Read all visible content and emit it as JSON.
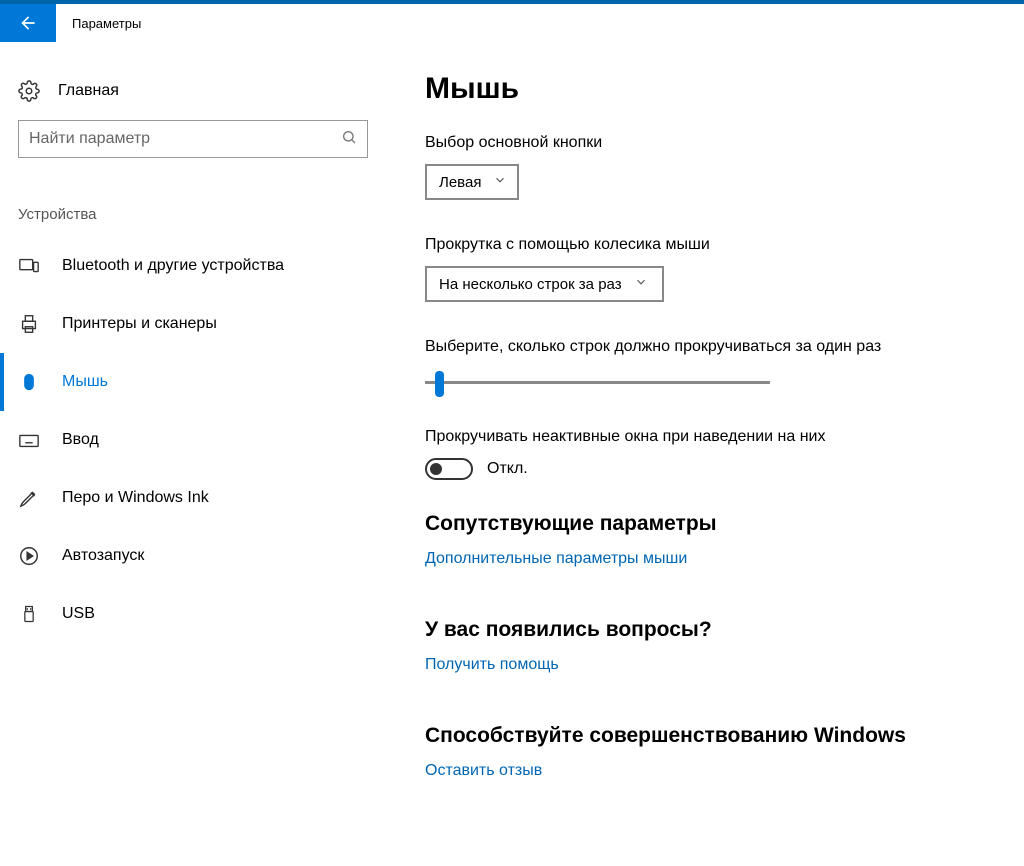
{
  "titlebar": {
    "title": "Параметры"
  },
  "sidebar": {
    "home": "Главная",
    "search_placeholder": "Найти параметр",
    "category": "Устройства",
    "items": [
      {
        "label": "Bluetooth и другие устройства"
      },
      {
        "label": "Принтеры и сканеры"
      },
      {
        "label": "Мышь"
      },
      {
        "label": "Ввод"
      },
      {
        "label": "Перо и Windows Ink"
      },
      {
        "label": "Автозапуск"
      },
      {
        "label": "USB"
      }
    ]
  },
  "main": {
    "heading": "Мышь",
    "primary_button_label": "Выбор основной кнопки",
    "primary_button_value": "Левая",
    "scroll_mode_label": "Прокрутка с помощью колесика мыши",
    "scroll_mode_value": "На несколько строк за раз",
    "lines_label": "Выберите, сколько строк должно прокручиваться за один раз",
    "inactive_label": "Прокручивать неактивные окна при наведении на них",
    "toggle_state": "Откл.",
    "related_heading": "Сопутствующие параметры",
    "related_link": "Дополнительные параметры мыши",
    "help_heading": "У вас появились вопросы?",
    "help_link": "Получить помощь",
    "feedback_heading": "Способствуйте совершенствованию Windows",
    "feedback_link": "Оставить отзыв"
  }
}
